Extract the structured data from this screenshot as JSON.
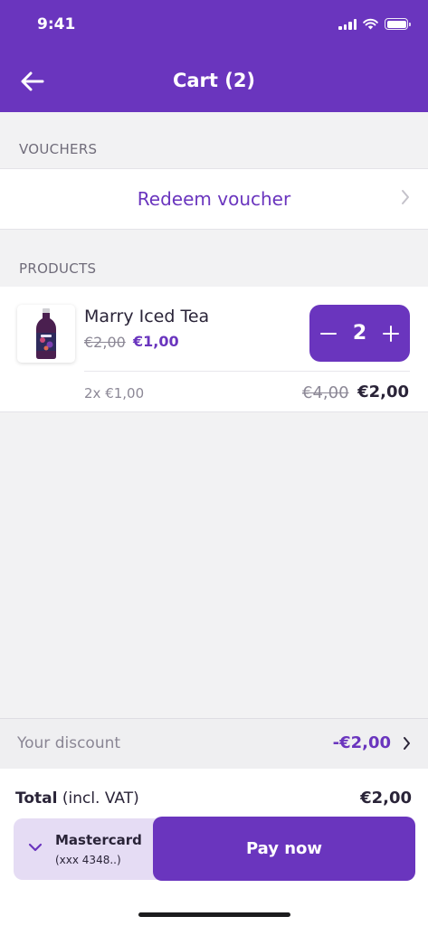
{
  "status_bar": {
    "time": "9:41"
  },
  "header": {
    "title": "Cart (2)",
    "back_icon": "arrow-left-icon"
  },
  "vouchers": {
    "section_label": "VOUCHERS",
    "redeem_label": "Redeem voucher"
  },
  "products": {
    "section_label": "PRODUCTS",
    "items": [
      {
        "name": "Marry Iced Tea",
        "old_price": "€2,00",
        "new_price": "€1,00",
        "quantity": "2",
        "unit_line": "2x €1,00",
        "total_old": "€4,00",
        "total_new": "€2,00"
      }
    ]
  },
  "discount": {
    "label": "Your discount",
    "value": "-€2,00"
  },
  "checkout": {
    "total_label": "Total",
    "total_suffix": "(incl. VAT)",
    "total_amount": "€2,00",
    "card_name": "Mastercard",
    "card_mask": "(xxx 4348..)",
    "pay_label": "Pay now"
  },
  "colors": {
    "accent": "#6a35be",
    "background": "#f2f2f3",
    "card_select_bg": "#e5dcf4"
  }
}
